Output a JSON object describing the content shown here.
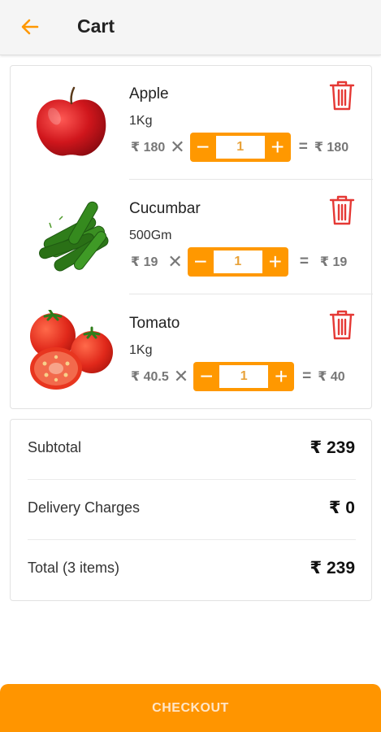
{
  "header": {
    "title": "Cart"
  },
  "items": [
    {
      "name": "Apple",
      "unit": "1Kg",
      "price": "₹ 180",
      "quantity": "1",
      "line_total": "₹ 180",
      "image": "apple-image"
    },
    {
      "name": "Cucumbar",
      "unit": "500Gm",
      "price": "₹ 19",
      "quantity": "1",
      "line_total": "₹ 19",
      "image": "cucumber-image"
    },
    {
      "name": "Tomato",
      "unit": "1Kg",
      "price": "₹ 40.5",
      "quantity": "1",
      "line_total": "₹ 40",
      "image": "tomato-image"
    }
  ],
  "symbols": {
    "multiply": "✕",
    "equals": "=",
    "minus": "−",
    "plus": "+"
  },
  "summary": {
    "subtotal_label": "Subtotal",
    "subtotal_value": "₹ 239",
    "delivery_label": "Delivery Charges",
    "delivery_value": "₹ 0",
    "total_label": "Total (3 items)",
    "total_value": "₹ 239"
  },
  "footer": {
    "checkout_label": "CHECKOUT"
  },
  "colors": {
    "accent": "#ff9800",
    "delete": "#e53935",
    "appbar": "#f5f5f5"
  }
}
